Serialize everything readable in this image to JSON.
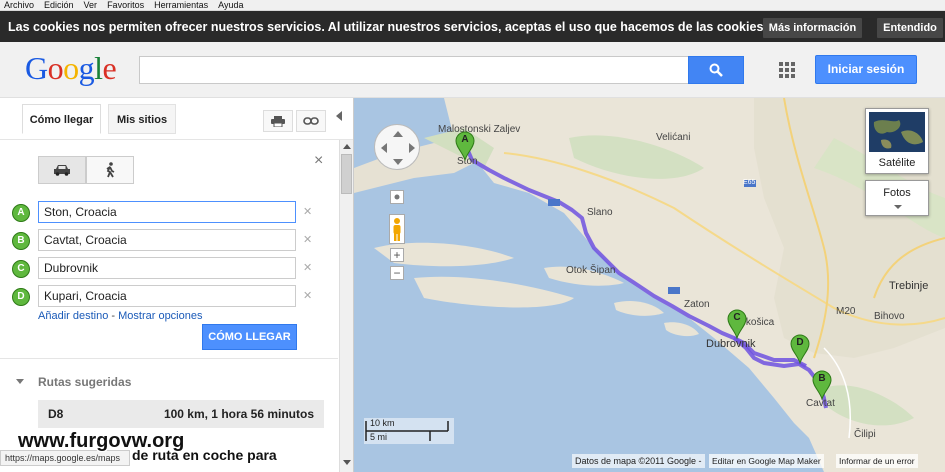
{
  "menubar": {
    "items": [
      "Archivo",
      "Edición",
      "Ver",
      "Favoritos",
      "Herramientas",
      "Ayuda"
    ]
  },
  "cookies": {
    "message": "Las cookies nos permiten ofrecer nuestros servicios. Al utilizar nuestros servicios, aceptas el uso que hacemos de las cookies.",
    "more_label": "Más información",
    "ok_label": "Entendido"
  },
  "header": {
    "logo": "Google",
    "search_value": "",
    "signin_label": "Iniciar sesión"
  },
  "panel": {
    "tab_directions": "Cómo llegar",
    "tab_myplaces": "Mis sitios",
    "waypoints": [
      {
        "letter": "A",
        "value": "Ston, Croacia"
      },
      {
        "letter": "B",
        "value": "Cavtat, Croacia"
      },
      {
        "letter": "C",
        "value": "Dubrovnik"
      },
      {
        "letter": "D",
        "value": "Kupari, Croacia"
      }
    ],
    "add_destination": "Añadir destino",
    "separator": " - ",
    "show_options": "Mostrar opciones",
    "go_label": "CÓMO LLEGAR",
    "routes_title": "Rutas sugeridas",
    "route": {
      "name": "D8",
      "info": "100 km, 1 hora 56 minutos"
    },
    "partial_text": "de ruta en coche para",
    "status_url": "https://maps.google.es/maps"
  },
  "watermark": "www.furgovw.org",
  "map": {
    "labels": {
      "malostonski": "Malostonski Zaljev",
      "ston": "Ston",
      "velicani": "Velićani",
      "slano": "Slano",
      "otok_sipan": "Otok Šipan",
      "zaton": "Zaton",
      "dubrovnik": "Dubrovnik",
      "trebinje": "Trebinje",
      "bihovo": "Bihovo",
      "m20": "M20",
      "e65": "E65",
      "cilipi": "Čilipi",
      "cavtat": "Cavtat",
      "mokosica": "Mokošica"
    },
    "satellite_label": "Satélite",
    "photos_label": "Fotos",
    "scale_km": "10 km",
    "scale_mi": "5 mi",
    "attribution": "Datos de mapa ©2011 Google -",
    "edit_link": "Editar en Google Map Maker",
    "report_link": "Informar de un error",
    "markers": [
      "A",
      "C",
      "D",
      "B"
    ],
    "route_color": "#6f52e0"
  }
}
